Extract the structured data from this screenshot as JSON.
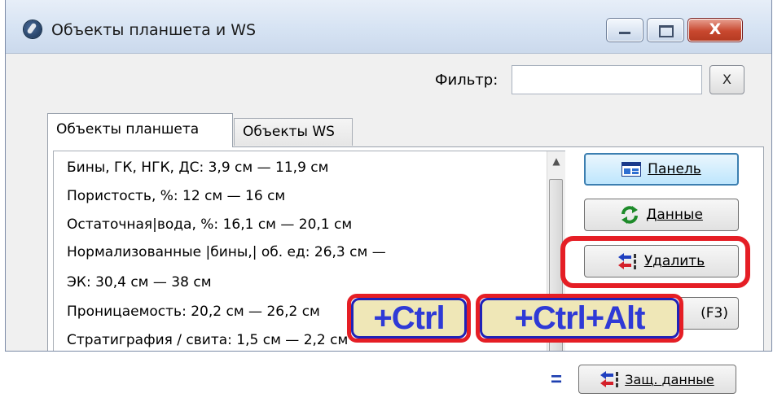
{
  "window": {
    "title": "Объекты планшета и WS",
    "close_glyph": "X"
  },
  "filter": {
    "label": "Фильтр:",
    "value": "",
    "placeholder": "",
    "clear_label": "X"
  },
  "tabs": [
    {
      "label": "Объекты планшета",
      "active": true
    },
    {
      "label": "Объекты WS",
      "active": false
    }
  ],
  "list": {
    "items": [
      "Бины, ГК, НГК, ДС: 3,9 см — 11,9 см",
      "Пористость, %: 12 см — 16 см",
      "Остаточная|вода, %: 16,1 см — 20,1 см",
      "Нормализованные |бины,| об. ед: 26,3 см —",
      "ЭК: 30,4 см — 38 см",
      "Проницаемость: 20,2 см — 26,2 см",
      "Стратиграфия / свита: 1,5 см — 2,2 см"
    ]
  },
  "buttons": {
    "panel": "Панель",
    "data": "Данные",
    "delete": "Удалить",
    "partial": "(F3)",
    "protected_data": "Защ. данные"
  },
  "annotations": {
    "hotkey_ctrl": "+Ctrl",
    "hotkey_ctrl_alt": "+Ctrl+Alt",
    "equals": "="
  },
  "colors": {
    "highlight_red": "#e51e25",
    "hotkey_blue": "#2f3ad6",
    "hotkey_bg": "#efe7b7",
    "primary_button_border": "#3c7fb1"
  },
  "icons": {
    "app": "app-logo-icon",
    "panel": "panel-window-icon",
    "data": "refresh-arrows-icon",
    "delete": "delete-arrows-icon"
  }
}
